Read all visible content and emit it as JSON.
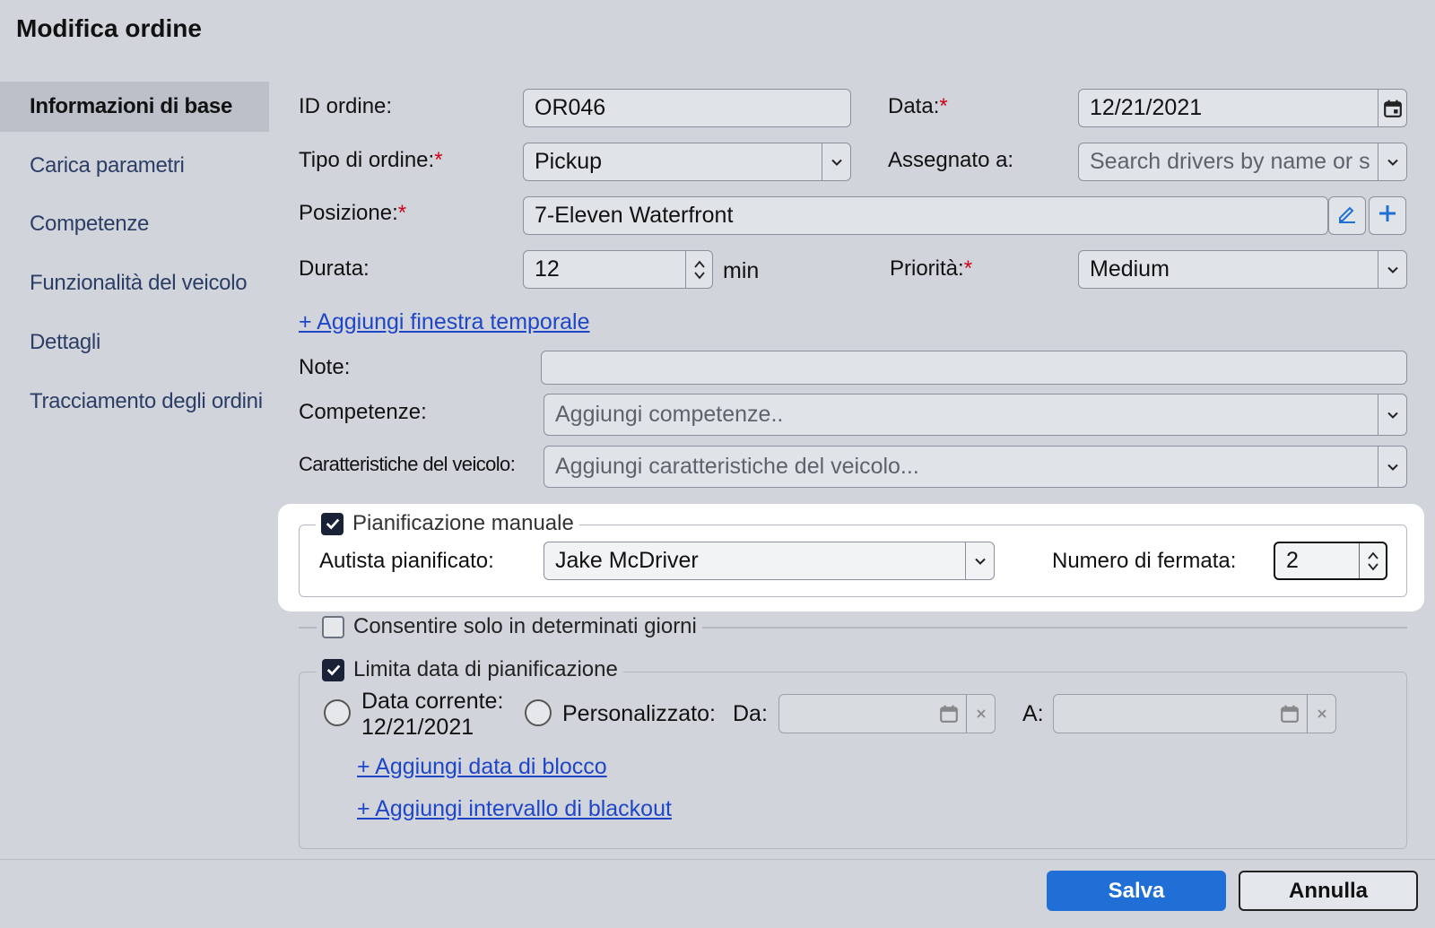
{
  "dialog": {
    "title": "Modifica ordine"
  },
  "sidebar": {
    "items": [
      {
        "label": "Informazioni di base",
        "active": true
      },
      {
        "label": "Carica parametri"
      },
      {
        "label": "Competenze"
      },
      {
        "label": "Funzionalità del veicolo"
      },
      {
        "label": "Dettagli"
      },
      {
        "label": "Tracciamento degli ordini"
      }
    ]
  },
  "form": {
    "order_id": {
      "label": "ID ordine:",
      "value": "OR046"
    },
    "date": {
      "label": "Data:",
      "required": "*",
      "value": "12/21/2021"
    },
    "order_type": {
      "label": "Tipo di ordine:",
      "required": "*",
      "value": "Pickup"
    },
    "assigned_to": {
      "label": "Assegnato a:",
      "placeholder": "Search drivers by name or s"
    },
    "location": {
      "label": "Posizione:",
      "required": "*",
      "value": "7-Eleven Waterfront"
    },
    "duration": {
      "label": "Durata:",
      "value": "12",
      "unit": "min"
    },
    "priority": {
      "label": "Priorità:",
      "required": "*",
      "value": "Medium"
    },
    "add_time_window": "+ Aggiungi finestra temporale",
    "notes": {
      "label": "Note:",
      "value": ""
    },
    "skills": {
      "label": "Competenze:",
      "placeholder": "Aggiungi competenze.."
    },
    "vehicle_features": {
      "label": "Caratteristiche del veicolo:",
      "placeholder": "Aggiungi caratteristiche del veicolo..."
    }
  },
  "manual_planning": {
    "label": "Pianificazione manuale",
    "checked": true,
    "driver_label": "Autista pianificato:",
    "driver_value": "Jake McDriver",
    "stop_label": "Numero di fermata:",
    "stop_value": "2"
  },
  "allowed_days": {
    "label": "Consentire solo in determinati giorni",
    "checked": false
  },
  "limit_date": {
    "label": "Limita data di pianificazione",
    "checked": true,
    "current_label": "Data corrente:",
    "current_date": "12/21/2021",
    "custom_label": "Personalizzato:",
    "from_label": "Da:",
    "to_label": "A:",
    "add_block_date": "+ Aggiungi data di blocco",
    "add_blackout": "+ Aggiungi intervallo di blackout"
  },
  "footer": {
    "save_label": "Salva",
    "cancel_label": "Annulla"
  },
  "colors": {
    "primary": "#1f6fd6",
    "link": "#1f46c8",
    "required": "#d0021b"
  }
}
